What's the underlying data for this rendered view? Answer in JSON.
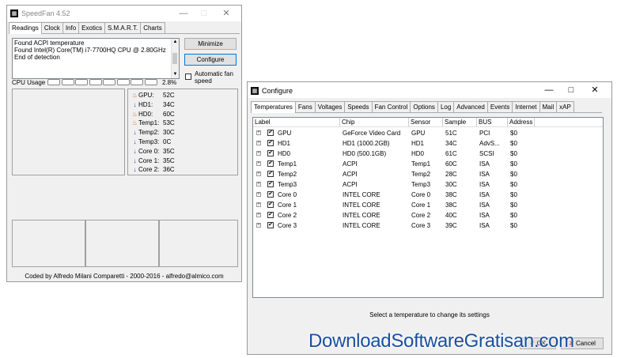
{
  "speedfan": {
    "title": "SpeedFan 4.52",
    "tabs": [
      "Readings",
      "Clock",
      "Info",
      "Exotics",
      "S.M.A.R.T.",
      "Charts"
    ],
    "active_tab": 0,
    "log": [
      "Found ACPI temperature",
      "Found Intel(R) Core(TM) i7-7700HQ CPU @ 2.80GHz",
      "End of detection"
    ],
    "minimize_label": "Minimize",
    "configure_label": "Configure",
    "auto_fan_label": "Automatic fan speed",
    "auto_fan_checked": false,
    "cpu_usage_label": "CPU Usage",
    "cpu_usage_value": "2.8%",
    "cpu_segments": 8,
    "readings": [
      {
        "icon": "flame",
        "label": "GPU:",
        "value": "52C"
      },
      {
        "icon": "down-arrow",
        "label": "HD1:",
        "value": "34C"
      },
      {
        "icon": "flame",
        "label": "HD0:",
        "value": "60C"
      },
      {
        "icon": "flame",
        "label": "Temp1:",
        "value": "53C"
      },
      {
        "icon": "down-arrow",
        "label": "Temp2:",
        "value": "30C"
      },
      {
        "icon": "down-arrow",
        "label": "Temp3:",
        "value": "0C"
      },
      {
        "icon": "down-arrow",
        "label": "Core 0:",
        "value": "35C"
      },
      {
        "icon": "down-arrow",
        "label": "Core 1:",
        "value": "35C"
      },
      {
        "icon": "down-arrow",
        "label": "Core 2:",
        "value": "36C"
      }
    ],
    "footer": "Coded by Alfredo Milani Comparetti - 2000-2016 - alfredo@almico.com"
  },
  "configure": {
    "title": "Configure",
    "tabs": [
      "Temperatures",
      "Fans",
      "Voltages",
      "Speeds",
      "Fan Control",
      "Options",
      "Log",
      "Advanced",
      "Events",
      "Internet",
      "Mail",
      "xAP"
    ],
    "active_tab": 0,
    "columns": [
      "Label",
      "Chip",
      "Sensor",
      "Sample",
      "BUS",
      "Address"
    ],
    "rows": [
      {
        "label": "GPU",
        "chip": "GeForce Video Card",
        "sensor": "GPU",
        "sample": "51C",
        "bus": "PCI",
        "address": "$0"
      },
      {
        "label": "HD1",
        "chip": "HD1 (1000.2GB)",
        "sensor": "HD1",
        "sample": "34C",
        "bus": "AdvS...",
        "address": "$0"
      },
      {
        "label": "HD0",
        "chip": "HD0 (500.1GB)",
        "sensor": "HD0",
        "sample": "61C",
        "bus": "SCSI",
        "address": "$0"
      },
      {
        "label": "Temp1",
        "chip": "ACPI",
        "sensor": "Temp1",
        "sample": "60C",
        "bus": "ISA",
        "address": "$0"
      },
      {
        "label": "Temp2",
        "chip": "ACPI",
        "sensor": "Temp2",
        "sample": "28C",
        "bus": "ISA",
        "address": "$0"
      },
      {
        "label": "Temp3",
        "chip": "ACPI",
        "sensor": "Temp3",
        "sample": "30C",
        "bus": "ISA",
        "address": "$0"
      },
      {
        "label": "Core 0",
        "chip": "INTEL CORE",
        "sensor": "Core 0",
        "sample": "38C",
        "bus": "ISA",
        "address": "$0"
      },
      {
        "label": "Core 1",
        "chip": "INTEL CORE",
        "sensor": "Core 1",
        "sample": "38C",
        "bus": "ISA",
        "address": "$0"
      },
      {
        "label": "Core 2",
        "chip": "INTEL CORE",
        "sensor": "Core 2",
        "sample": "40C",
        "bus": "ISA",
        "address": "$0"
      },
      {
        "label": "Core 3",
        "chip": "INTEL CORE",
        "sensor": "Core 3",
        "sample": "39C",
        "bus": "ISA",
        "address": "$0"
      }
    ],
    "hint": "Select a temperature to change its settings",
    "ok_label": "OK",
    "cancel_label": "Cancel"
  },
  "watermark": "DownloadSoftwareGratisan.com",
  "colors": {
    "flame": "#e05a10",
    "arrow": "#1a44c8",
    "watermark": "#1b4fa0"
  }
}
